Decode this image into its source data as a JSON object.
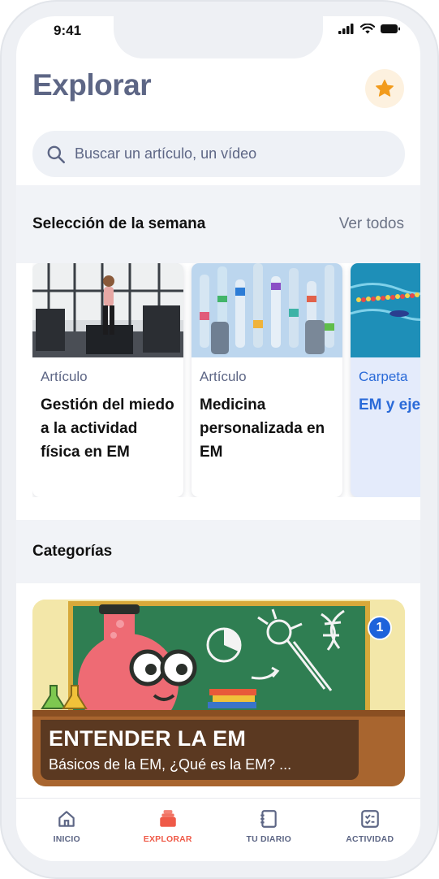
{
  "status": {
    "time": "9:41"
  },
  "header": {
    "title": "Explorar",
    "favorite_icon": "star-icon"
  },
  "search": {
    "placeholder": "Buscar un artículo, un vídeo",
    "icon": "search-icon"
  },
  "weekly": {
    "title": "Selección de la semana",
    "see_all": "Ver todos",
    "cards": [
      {
        "type": "Artículo",
        "title": "Gestión del miedo a la actividad física en EM"
      },
      {
        "type": "Artículo",
        "title": "Medicina personalizada en EM"
      },
      {
        "type": "Carpeta",
        "title": "EM y eje"
      }
    ]
  },
  "categories": {
    "title": "Categorías",
    "items": [
      {
        "title": "ENTENDER LA EM",
        "subtitle": "Básicos de la EM, ¿Qué es la EM? ...",
        "badge": "1"
      }
    ]
  },
  "tabbar": {
    "items": [
      {
        "label": "INICIO",
        "icon": "home-icon",
        "active": false
      },
      {
        "label": "EXPLORAR",
        "icon": "stack-icon",
        "active": true
      },
      {
        "label": "TU DIARIO",
        "icon": "journal-icon",
        "active": false
      },
      {
        "label": "ACTIVIDAD",
        "icon": "checklist-icon",
        "active": false
      }
    ]
  },
  "colors": {
    "accent": "#ef5a48",
    "title": "#5d6685",
    "star": "#f29b1c",
    "link": "#2a6ad8",
    "badge": "#1e63db"
  }
}
